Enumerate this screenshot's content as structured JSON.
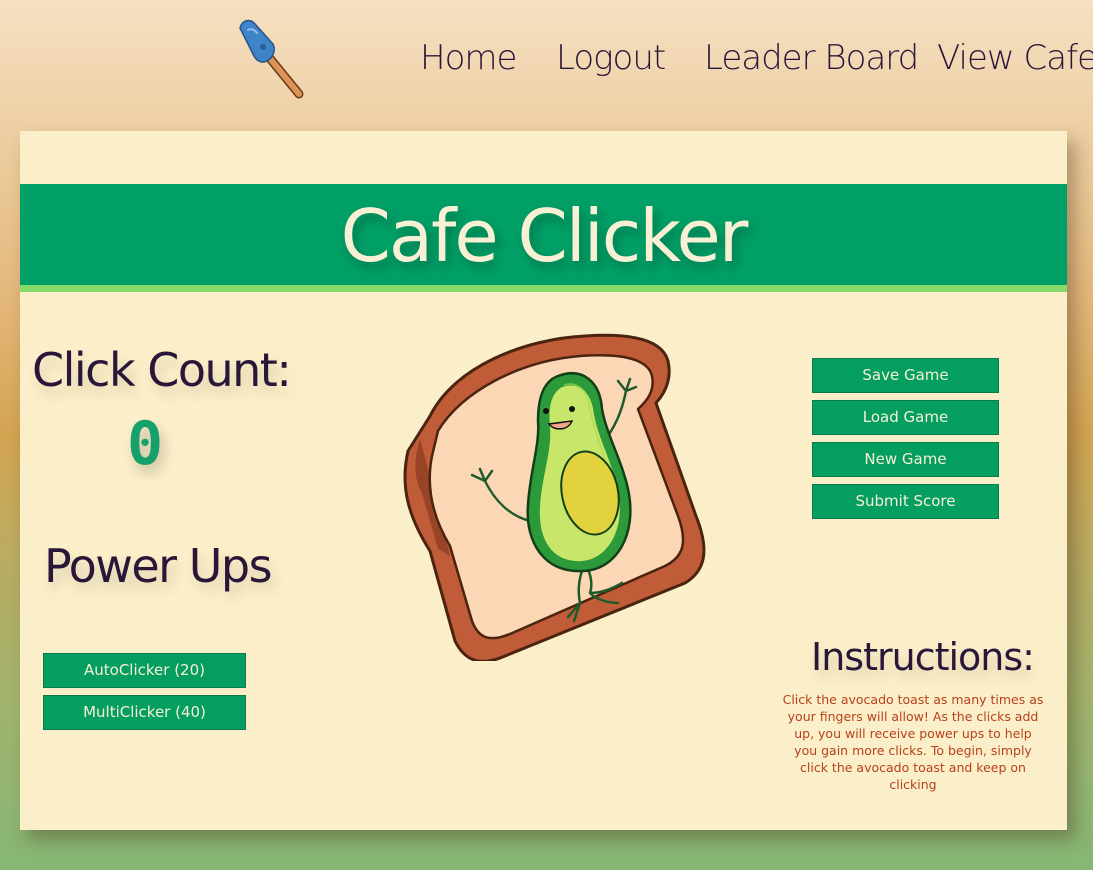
{
  "nav": {
    "logo_icon": "spatula-icon",
    "links": [
      "Home",
      "Logout",
      "Leader Board",
      "View Cafe"
    ]
  },
  "banner": {
    "title": "Cafe Clicker"
  },
  "stats": {
    "click_label": "Click Count:",
    "click_count": "0"
  },
  "powerups": {
    "title": "Power Ups",
    "buttons": [
      "AutoClicker (20)",
      "MultiClicker (40)"
    ]
  },
  "game_actions": [
    "Save Game",
    "Load Game",
    "New Game",
    "Submit Score"
  ],
  "clicker": {
    "icon": "avocado-toast-icon"
  },
  "instructions": {
    "title": "Instructions:",
    "text": "Click the avocado toast as many times as your fingers will allow! As the clicks add up, you will receive power ups to help you gain more clicks. To begin, simply click the avocado toast and keep on clicking"
  },
  "colors": {
    "accent_green": "#009f66",
    "banner_stripe": "#86d96b",
    "card_bg": "#fbefc9",
    "text_dark": "#2a1638",
    "instructions_text": "#b8401c"
  }
}
